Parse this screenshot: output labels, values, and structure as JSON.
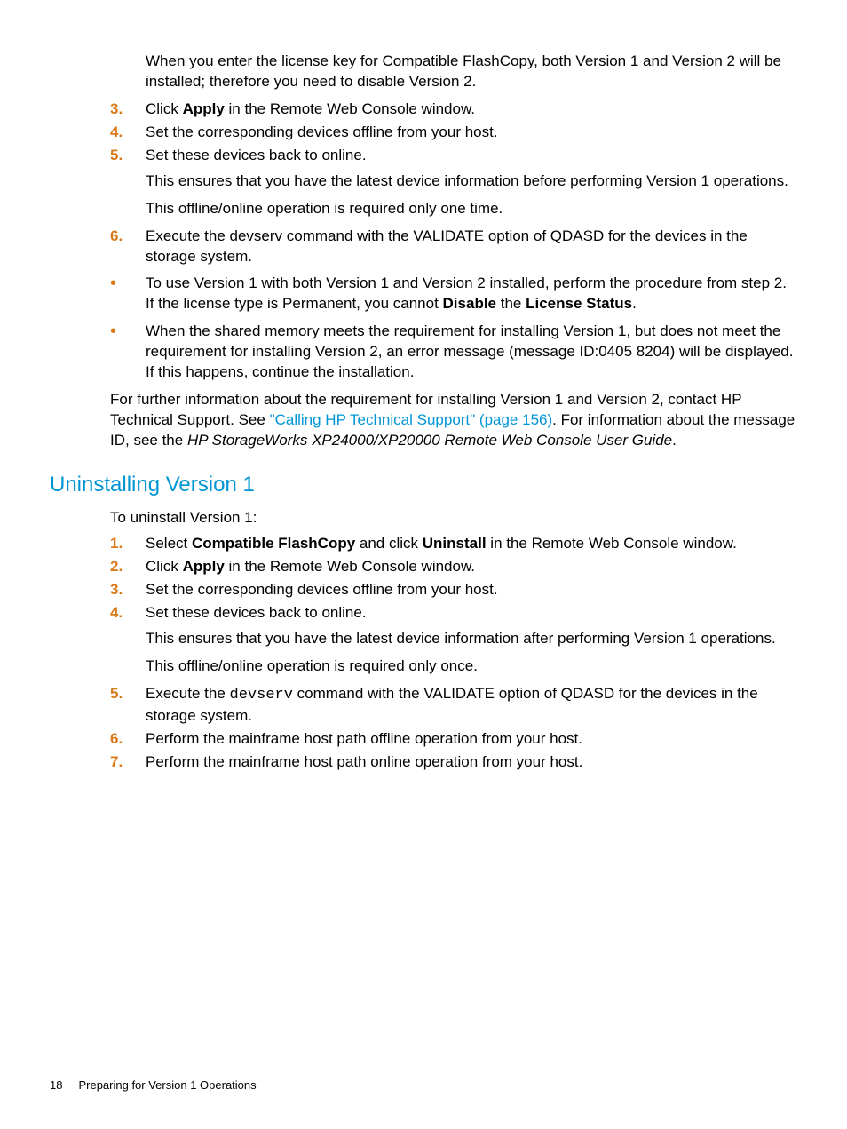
{
  "intro_paragraph": "When you enter the license key for Compatible FlashCopy, both Version 1 and Version 2 will be installed; therefore you need to disable Version 2.",
  "list1": {
    "item3": {
      "num": "3.",
      "pre": "Click ",
      "bold": "Apply",
      "post": " in the Remote Web Console window."
    },
    "item4": {
      "num": "4.",
      "text": "Set the corresponding devices offline from your host."
    },
    "item5": {
      "num": "5.",
      "text": "Set these devices back to online.",
      "p2": "This ensures that you have the latest device information before performing Version 1 operations.",
      "p3": "This offline/online operation is required only one time."
    },
    "item6": {
      "num": "6.",
      "text": "Execute the devserv command with the VALIDATE option of QDASD for the devices in the storage system."
    },
    "bullet1": {
      "pre": "To use Version 1 with both Version 1 and Version 2 installed, perform the procedure from step 2. If the license type is Permanent, you cannot ",
      "b1": "Disable",
      "mid": " the ",
      "b2": "License Status",
      "post": "."
    },
    "bullet2": {
      "text": "When the shared memory meets the requirement for installing Version 1, but does not meet the requirement for installing Version 2, an error message (message ID:0405 8204) will be displayed. If this happens, continue the installation."
    }
  },
  "after1": {
    "p1_pre": "For further information about the requirement for installing Version 1 and Version 2, contact HP Technical Support. See ",
    "p1_link": "\"Calling HP Technical Support\" (page 156)",
    "p1_mid": ". For information about the message ID, see the ",
    "p1_italic": "HP StorageWorks XP24000/XP20000 Remote Web Console User Guide",
    "p1_post": "."
  },
  "section_heading": "Uninstalling Version 1",
  "sub_intro": "To uninstall Version 1:",
  "list2": {
    "item1": {
      "num": "1.",
      "pre": "Select ",
      "b1": "Compatible FlashCopy",
      "mid": " and click ",
      "b2": "Uninstall",
      "post": " in the Remote Web Console window."
    },
    "item2": {
      "num": "2.",
      "pre": "Click ",
      "bold": "Apply",
      "post": " in the Remote Web Console window."
    },
    "item3": {
      "num": "3.",
      "text": "Set the corresponding devices offline from your host."
    },
    "item4": {
      "num": "4.",
      "text": "Set these devices back to online.",
      "p2": "This ensures that you have the latest device information after performing Version 1 operations.",
      "p3": "This offline/online operation is required only once."
    },
    "item5": {
      "num": "5.",
      "pre": "Execute the ",
      "mono": "devserv",
      "post": " command with the VALIDATE option of QDASD for the devices in the storage system."
    },
    "item6": {
      "num": "6.",
      "text": "Perform the mainframe host path offline operation from your host."
    },
    "item7": {
      "num": "7.",
      "text": "Perform the mainframe host path online operation from your host."
    }
  },
  "footer": {
    "page": "18",
    "title": "Preparing for Version 1 Operations"
  }
}
